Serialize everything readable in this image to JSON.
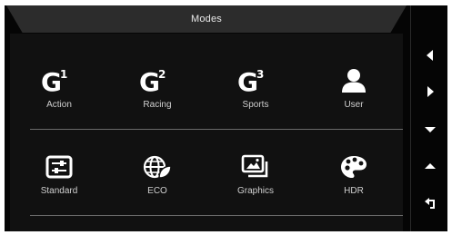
{
  "window": {
    "title": "Modes"
  },
  "modes_row1": [
    {
      "label": "Action",
      "icon": "g1-icon",
      "glyph": "G",
      "sup": "1"
    },
    {
      "label": "Racing",
      "icon": "g2-icon",
      "glyph": "G",
      "sup": "2"
    },
    {
      "label": "Sports",
      "icon": "g3-icon",
      "glyph": "G",
      "sup": "3"
    },
    {
      "label": "User",
      "icon": "user-icon"
    }
  ],
  "modes_row2": [
    {
      "label": "Standard",
      "icon": "sliders-icon"
    },
    {
      "label": "ECO",
      "icon": "eco-globe-icon"
    },
    {
      "label": "Graphics",
      "icon": "pictures-icon"
    },
    {
      "label": "HDR",
      "icon": "palette-icon"
    }
  ],
  "controls": [
    "left-arrow-icon",
    "right-arrow-icon",
    "down-arrow-icon",
    "up-arrow-icon",
    "back-icon"
  ],
  "colors": {
    "background": "#050505",
    "panel": "#111111",
    "title_bar": "#2c2c2c",
    "text": "#cfcfcf",
    "icon": "#ffffff"
  }
}
